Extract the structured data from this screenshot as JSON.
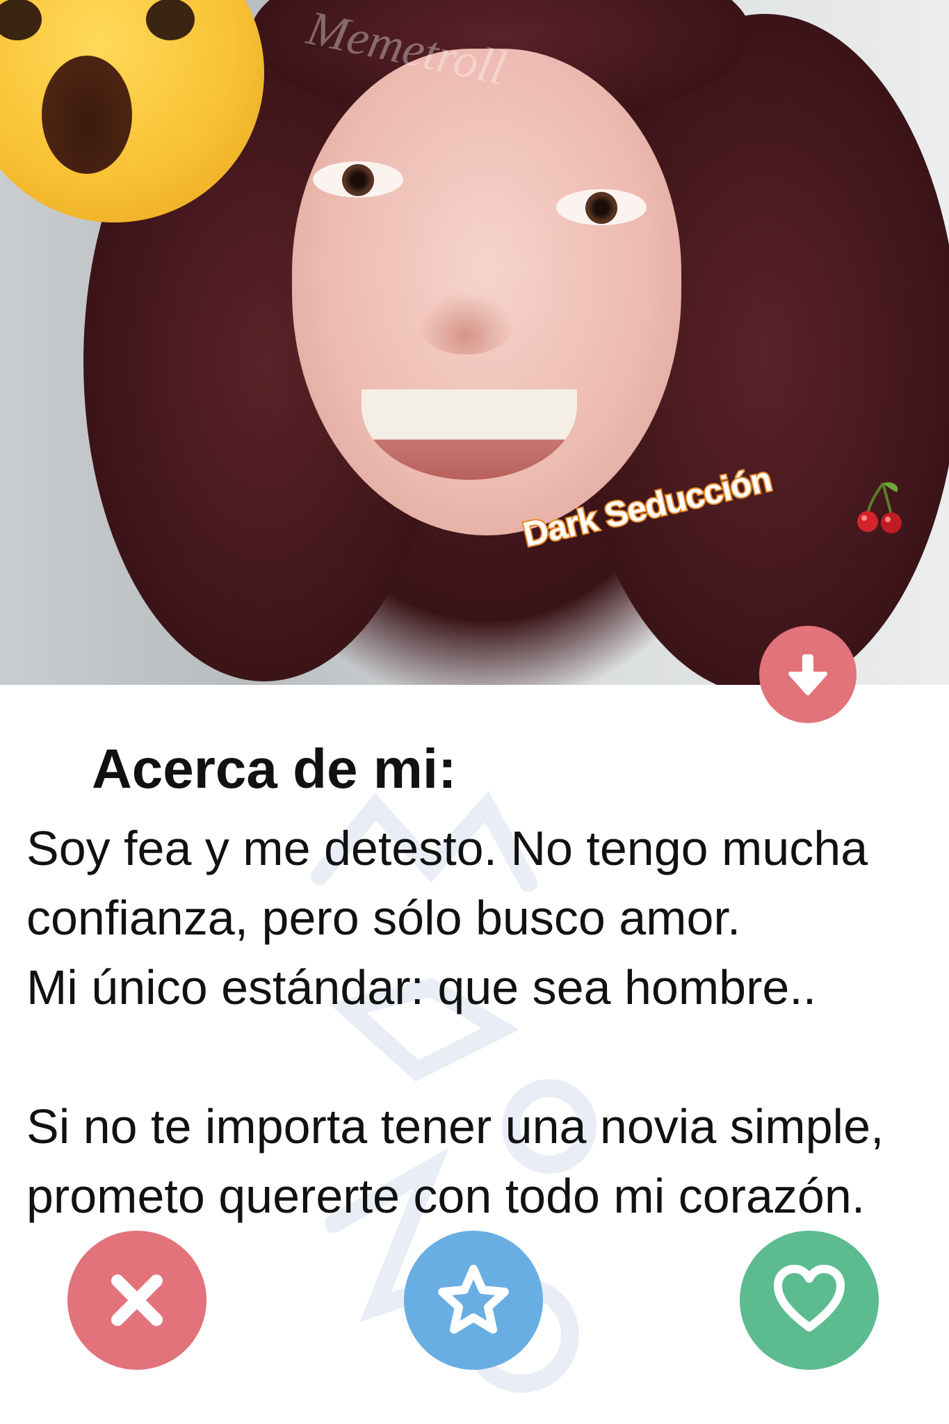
{
  "profile": {
    "brand_label": "Dark Seducción",
    "photo_watermark": "Memetroll"
  },
  "about": {
    "title": "Acerca de mi:",
    "bio_lines": [
      "Soy fea y me detesto. No tengo mucha",
      "confianza, pero sólo busco amor.",
      "Mi único estándar: que sea hombre..",
      "",
      "Si no te importa tener una novia simple,",
      "prometo quererte con todo mi corazón."
    ]
  },
  "icons": {
    "emoji": "astonished-face-icon",
    "expand": "arrow-down-icon",
    "nope": "close-icon",
    "super_like": "star-icon",
    "like": "heart-icon",
    "cherry": "cherry-icon"
  },
  "colors": {
    "nope": "#e2737b",
    "super_like": "#69aee3",
    "like": "#5cbb8f",
    "brand_outline": "#e88a2a"
  }
}
